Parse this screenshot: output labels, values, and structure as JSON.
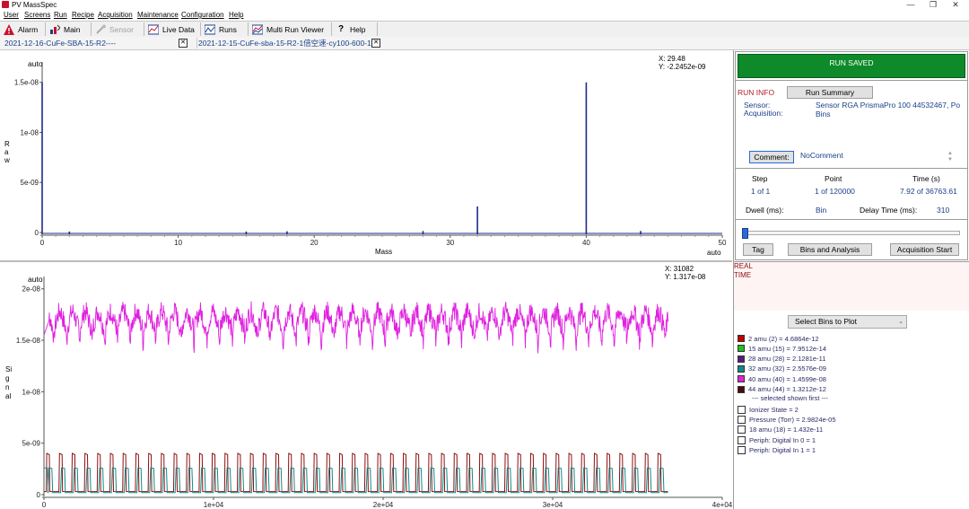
{
  "window": {
    "title": "PV MassSpec",
    "minimize": "—",
    "maximize": "❐",
    "close": "✕"
  },
  "menu": [
    "User",
    "Screens",
    "Run",
    "Recipe",
    "Acquisition",
    "Maintenance",
    "Configuration",
    "Help"
  ],
  "toolbar": {
    "alarm": "Alarm",
    "main": "Main",
    "sensor": "Sensor",
    "live_data": "Live Data",
    "runs": "Runs",
    "multi_run_viewer": "Multi Run Viewer",
    "help": "Help"
  },
  "run_tabs": [
    {
      "label": "2021-12-16-CuFe-SBA-15-R2----",
      "close": "✕"
    },
    {
      "label": "2021-12-15-CuFe-sba-15-R2-1倍空速-cy100-600-1",
      "close": "✕"
    }
  ],
  "colors": {
    "mass_line": "#1f2a8a",
    "run_saved_bg": "#0e8a2a",
    "run_info_label": "#b0202a",
    "amu40": "#e020e0",
    "amu2": "#8b1010",
    "amu32": "#108a8a"
  },
  "top_chart": {
    "scale_label": "auto",
    "cursor_x": "X: 29.48",
    "cursor_y": "Y: -2.2452e-09",
    "y_ticks": [
      "1.5e-08",
      "1e-08",
      "5e-09",
      "0"
    ],
    "x_ticks": [
      "0",
      "10",
      "20",
      "30",
      "40",
      "50"
    ],
    "x_auto": "auto",
    "ylabel": "Raw",
    "xlabel": "Mass"
  },
  "bottom_chart": {
    "scale_label": "auto",
    "cursor_x": "X: 31082",
    "cursor_y": "Y: 1.317e-08",
    "y_ticks": [
      "2e-08",
      "1.5e-08",
      "1e-08",
      "5e-09",
      "0"
    ],
    "x_ticks": [
      "0",
      "1e+04",
      "2e+04",
      "3e+04",
      "4e+04"
    ],
    "ylabel": "Signal"
  },
  "chart_data": [
    {
      "type": "bar",
      "xlabel": "Mass",
      "ylabel": "Raw",
      "xlim": [
        0,
        50
      ],
      "ylim": [
        0,
        1.65e-08
      ],
      "x_ticks": [
        0,
        10,
        20,
        30,
        40,
        50
      ],
      "y_ticks": [
        0,
        5e-09,
        1e-08,
        1.5e-08
      ],
      "peaks": [
        {
          "mass": 0,
          "value": 1.5e-08
        },
        {
          "mass": 2,
          "value": 1e-10
        },
        {
          "mass": 15,
          "value": 1e-10
        },
        {
          "mass": 18,
          "value": 1.2e-10
        },
        {
          "mass": 28,
          "value": 1.5e-10
        },
        {
          "mass": 32,
          "value": 2.6e-09
        },
        {
          "mass": 40,
          "value": 1.5e-08
        },
        {
          "mass": 44,
          "value": 1.5e-10
        }
      ]
    },
    {
      "type": "line",
      "ylabel": "Signal",
      "xlim": [
        0,
        40000
      ],
      "ylim": [
        0,
        2.05e-08
      ],
      "x_ticks": [
        0,
        10000,
        20000,
        30000,
        40000
      ],
      "y_ticks": [
        0,
        5e-09,
        1e-08,
        1.5e-08,
        2e-08
      ],
      "series": [
        {
          "name": "40 amu (40)",
          "x_range": [
            0,
            36800
          ],
          "baseline": 1.7e-08,
          "peak": 1.9e-08,
          "trough": 1.55e-08,
          "cycles": 49
        },
        {
          "name": "2 amu (2)",
          "x_range": [
            0,
            36800
          ],
          "baseline": 3e-10,
          "peak": 4e-09,
          "cycles": 49
        },
        {
          "name": "32 amu (32)",
          "x_range": [
            0,
            36800
          ],
          "baseline": 2e-10,
          "peak": 2.6e-09,
          "cycles": 49
        }
      ]
    }
  ],
  "run_status": "RUN SAVED",
  "run_info": {
    "label": "RUN INFO",
    "summary_button": "Run Summary",
    "sensor_label": "Sensor:",
    "sensor_value": "Sensor RGA PrismaPro 100 44532467, Po",
    "acquisition_label": "Acquisition:",
    "acquisition_value": "Bins",
    "comment_button": "Comment:",
    "comment_value": "NoComment"
  },
  "progress": {
    "step_label": "Step",
    "step_value": "1 of 1",
    "point_label": "Point",
    "point_value": "1 of 120000",
    "time_label": "Time (s)",
    "time_value": "7.92 of 36763.61",
    "dwell_label": "Dwell (ms):",
    "dwell_value": "Bin",
    "delay_label": "Delay Time (ms):",
    "delay_value": "310",
    "position_fraction": 0.0002
  },
  "actions": {
    "tag": "Tag",
    "bins_analysis": "Bins and Analysis",
    "acq_start": "Acquisition Start"
  },
  "realtime": {
    "line1": "REAL",
    "line2": "TIME"
  },
  "bins_select": "Select Bins to Plot",
  "bins_legend": [
    {
      "label": "2 amu (2) = 4.6864e-12",
      "color": "#c00000"
    },
    {
      "label": "15 amu (15) = 7.9512e-14",
      "color": "#20c020"
    },
    {
      "label": "28 amu (28) = 2.1281e-11",
      "color": "#5a1a7a"
    },
    {
      "label": "32 amu (32) = 2.5576e-09",
      "color": "#108a8a"
    },
    {
      "label": "40 amu (40) = 1.4599e-08",
      "color": "#e020e0"
    },
    {
      "label": "44 amu (44) = 1.3212e-12",
      "color": "#4a0a0a"
    }
  ],
  "bins_divider": "--- selected shown first ---",
  "bins_unselected": [
    "Ionizer State = 2",
    "Pressure (Torr) = 2.9824e-05",
    "18 amu (18) = 1.432e-11",
    "Periph: Digital In 0 = 1",
    "Periph: Digital In 1 = 1"
  ]
}
